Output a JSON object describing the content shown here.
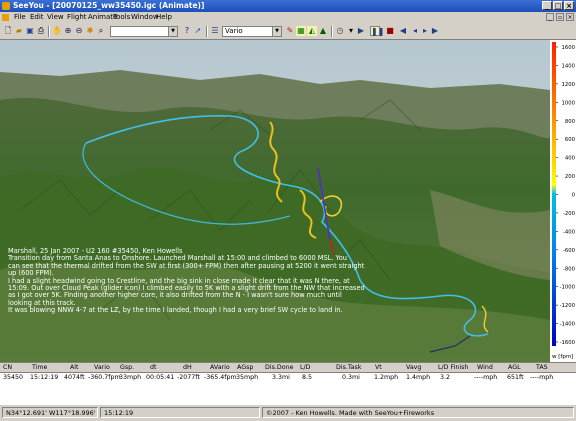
{
  "window": {
    "title": "SeeYou - [20070125_ww35450.igc (Animate)]"
  },
  "menu": [
    "File",
    "Edit",
    "View",
    "Flight",
    "Animate",
    "Tools",
    "Window",
    "Help"
  ],
  "toolbar": {
    "glider_combo": "Vario"
  },
  "flight_notes": [
    "Marshall, 25 Jan 2007 - U2 160 #35450, Ken Howells",
    "Transition day from Santa Anas to Onshore.  Launched Marshall at 15:00 and climbed to 6000 MSL.  You",
    "can see that the thermal drifted from the SW at first (300+ FPM) then after pausing at 5200 it went straight",
    "up (600 FPM).",
    "I had a slight headwind going to Crestline, and the big sink in close made it clear that it was N there, at",
    "15:09.  Out over Cloud Peak (glider icon) I climbed easily to 5K with a slight drift from the NW that increased",
    "as I got over 5K. Finding another higher core, it also drifted from the N - I wasn't sure how much until",
    "looking at this track.",
    "It was blowing NNW 4-7 at the LZ, by the time I landed, though I had a very brief SW cycle to land in."
  ],
  "vario_scale": {
    "ticks": [
      "1600",
      "1400",
      "1200",
      "1000",
      "800",
      "600",
      "400",
      "200",
      "0",
      "-200",
      "-400",
      "-600",
      "-800",
      "-1000",
      "-1200",
      "-1400",
      "-1600"
    ],
    "unit": "w [fpm]",
    "colors": [
      "#ff2000",
      "#ff8000",
      "#ffd000",
      "#ffff00",
      "#00c0e0",
      "#0060ff",
      "#0000c0"
    ]
  },
  "grid": {
    "headers": [
      "CN",
      "Time",
      "Alt",
      "Vario",
      "Gsp.",
      "dt",
      "dH",
      "AVario",
      "AGsp",
      "Dis.Done",
      "L/D",
      "Dis.Task",
      "Vt",
      "Vavg",
      "L/D Finish",
      "Wind",
      "AGL",
      "TAS"
    ],
    "row": [
      "35450",
      "15:12:19",
      "4074ft",
      "-360.7fpm",
      "33mph",
      "00:05:41",
      "-2077ft",
      "-365.4fpm",
      "35mph",
      "3.3mi",
      "8.5",
      "0.3mi",
      "1.2mph",
      "1.4mph",
      "3.2",
      "----mph",
      "651ft",
      "----mph"
    ]
  },
  "status": {
    "coords": "N34°12.691' W117°18.996'",
    "time": "15:12:19",
    "copyright": "©2007 - Ken Howells. Made with SeeYou+Fireworks"
  }
}
